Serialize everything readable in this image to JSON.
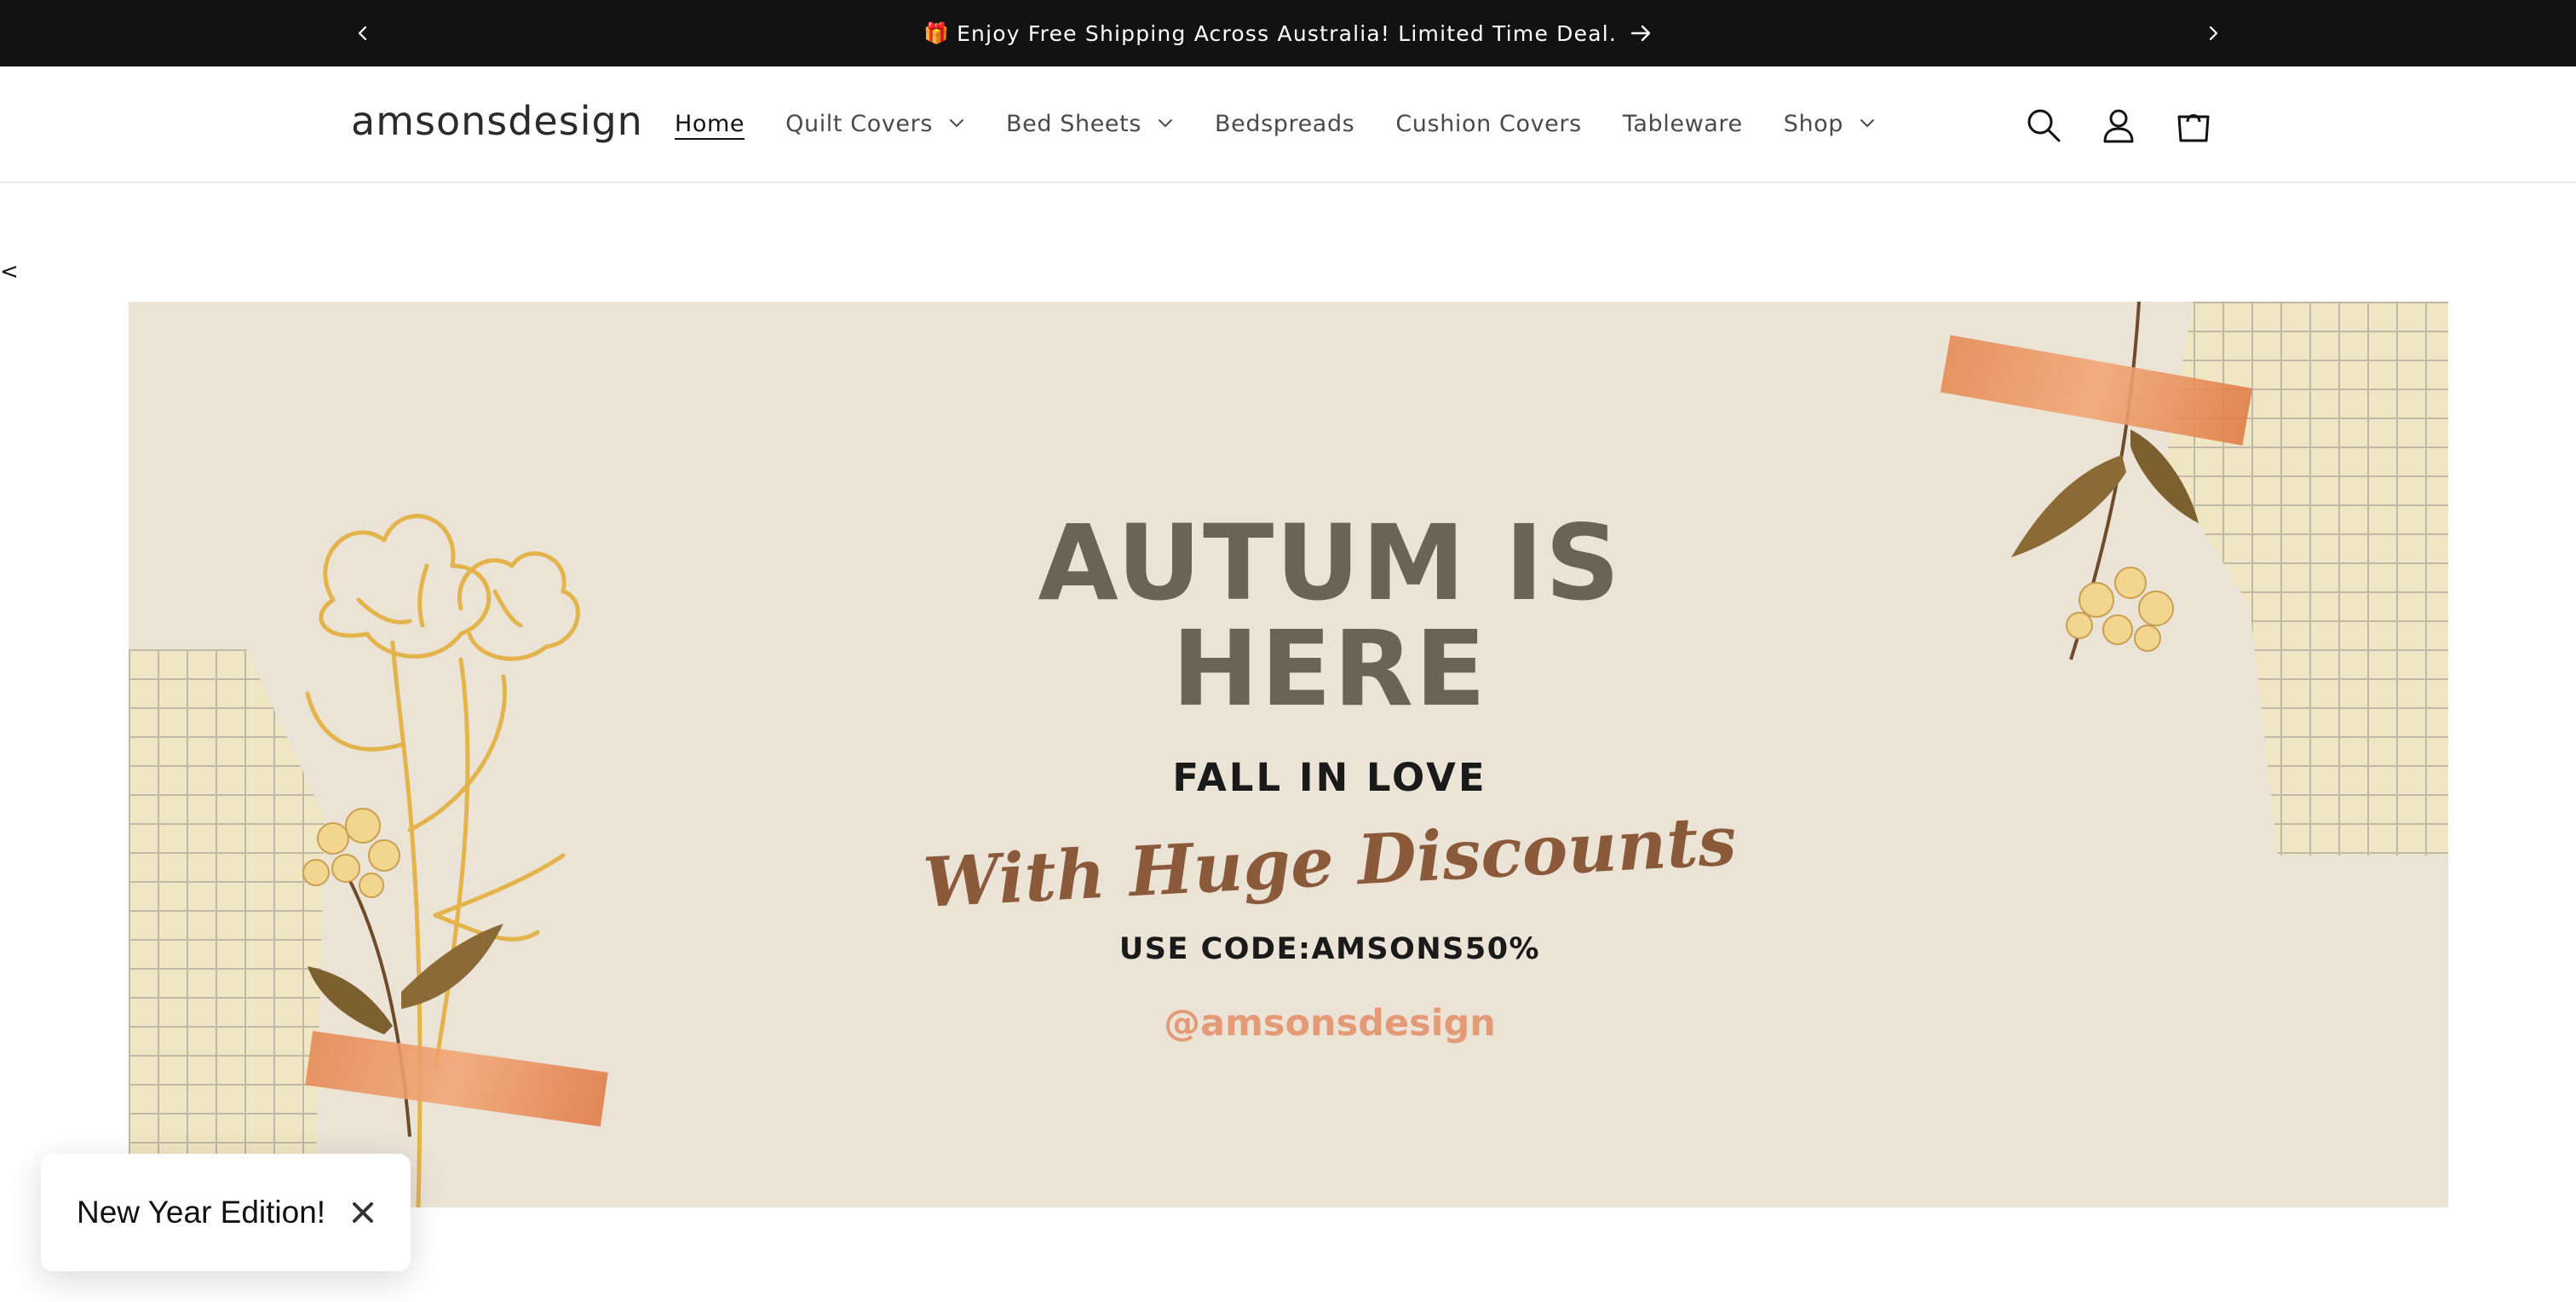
{
  "announcement": {
    "gift_icon": "🎁",
    "message": "Enjoy Free Shipping Across Australia! Limited Time Deal.",
    "prev_icon": "chevron-left-icon",
    "next_icon": "chevron-right-icon",
    "arrow_icon": "arrow-right-icon"
  },
  "header": {
    "logo": "amsonsdesign",
    "nav": [
      {
        "label": "Home",
        "active": true,
        "has_dropdown": false
      },
      {
        "label": "Quilt Covers",
        "active": false,
        "has_dropdown": true
      },
      {
        "label": "Bed Sheets",
        "active": false,
        "has_dropdown": true
      },
      {
        "label": "Bedspreads",
        "active": false,
        "has_dropdown": false
      },
      {
        "label": "Cushion Covers",
        "active": false,
        "has_dropdown": false
      },
      {
        "label": "Tableware",
        "active": false,
        "has_dropdown": false
      },
      {
        "label": "Shop",
        "active": false,
        "has_dropdown": true
      }
    ],
    "icons": [
      "search-icon",
      "account-icon",
      "cart-icon"
    ]
  },
  "slideshow": {
    "prev_label": "<"
  },
  "hero": {
    "title_line1": "AUTUM IS",
    "title_line2": "HERE",
    "subtitle": "FALL IN LOVE",
    "script_text": "With Huge Discounts",
    "code_text": "USE CODE:AMSONS50%",
    "handle": "@amsonsdesign"
  },
  "toast": {
    "label": "New Year Edition!",
    "close_icon": "close-icon"
  },
  "colors": {
    "announcement_bg": "#121212",
    "hero_bg": "#ece3d7",
    "hero_title": "#6b6356",
    "hero_script": "#8b5a3a",
    "hero_handle": "#e59a77",
    "flower_line": "#e3b44b"
  }
}
